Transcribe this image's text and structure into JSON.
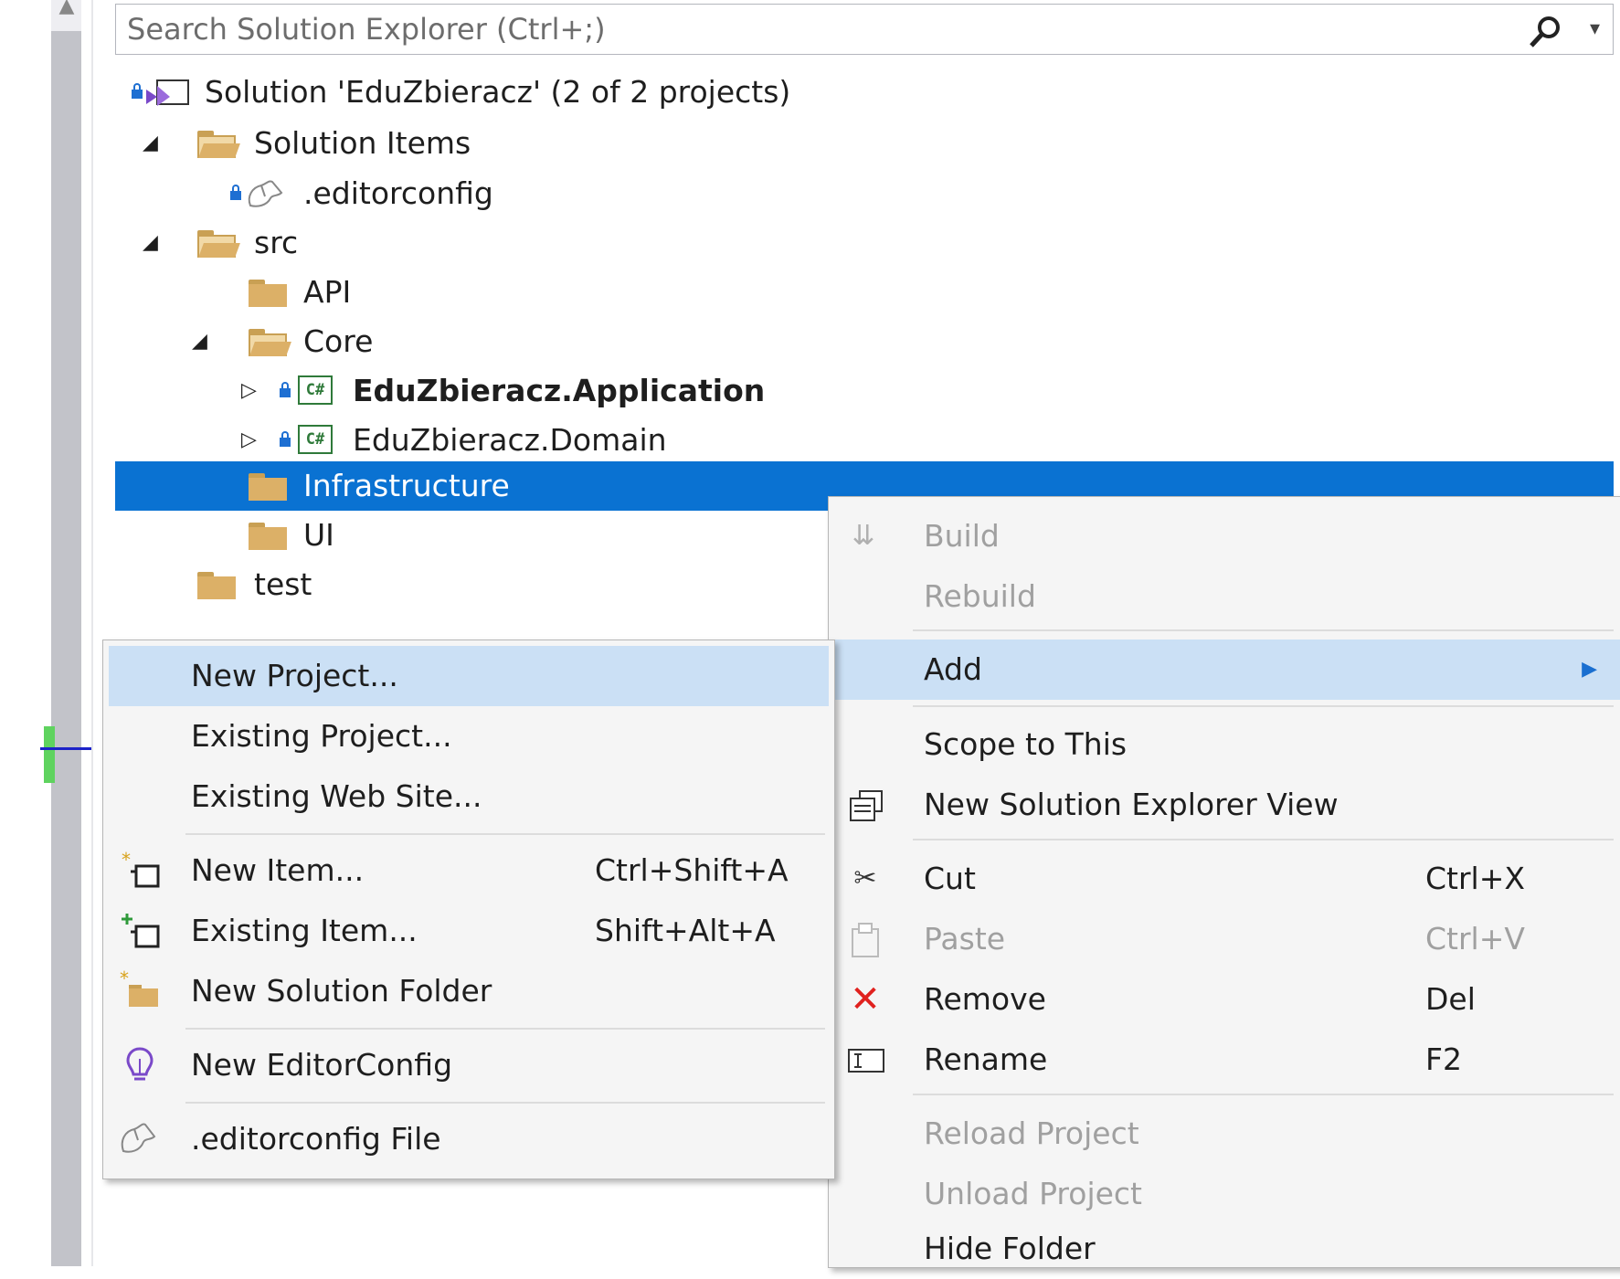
{
  "search": {
    "placeholder": "Search Solution Explorer (Ctrl+;)"
  },
  "tree": {
    "solution": "Solution 'EduZbieracz' (2 of 2 projects)",
    "solution_items": "Solution Items",
    "editorconfig": ".editorconfig",
    "src": "src",
    "api": "API",
    "core": "Core",
    "project_application": "EduZbieracz.Application",
    "project_domain": "EduZbieracz.Domain",
    "infrastructure": "Infrastructure",
    "ui": "UI",
    "test": "test",
    "csharp_badge": "C#"
  },
  "context_menu": {
    "build": "Build",
    "rebuild": "Rebuild",
    "add": "Add",
    "scope_to_this": "Scope to This",
    "new_solution_explorer_view": "New Solution Explorer View",
    "cut": "Cut",
    "cut_shortcut": "Ctrl+X",
    "paste": "Paste",
    "paste_shortcut": "Ctrl+V",
    "remove": "Remove",
    "remove_shortcut": "Del",
    "rename": "Rename",
    "rename_shortcut": "F2",
    "reload_project": "Reload Project",
    "unload_project": "Unload Project",
    "hide_folder": "Hide Folder"
  },
  "add_submenu": {
    "new_project": "New Project...",
    "existing_project": "Existing Project...",
    "existing_web_site": "Existing Web Site...",
    "new_item": "New Item...",
    "new_item_shortcut": "Ctrl+Shift+A",
    "existing_item": "Existing Item...",
    "existing_item_shortcut": "Shift+Alt+A",
    "new_solution_folder": "New Solution Folder",
    "new_editorconfig": "New EditorConfig",
    "editorconfig_file": ".editorconfig File"
  },
  "colors": {
    "selection": "#0a72d2",
    "menu_highlight": "#cbe0f5",
    "remove_icon": "#e0211e",
    "disabled_text": "#a0a0a0"
  },
  "icons": {
    "search": "search-icon",
    "folder": "folder-icon",
    "lock": "lock-icon",
    "csharp_project": "csharp-project-icon",
    "cut": "scissors-icon",
    "remove": "red-x-icon"
  }
}
